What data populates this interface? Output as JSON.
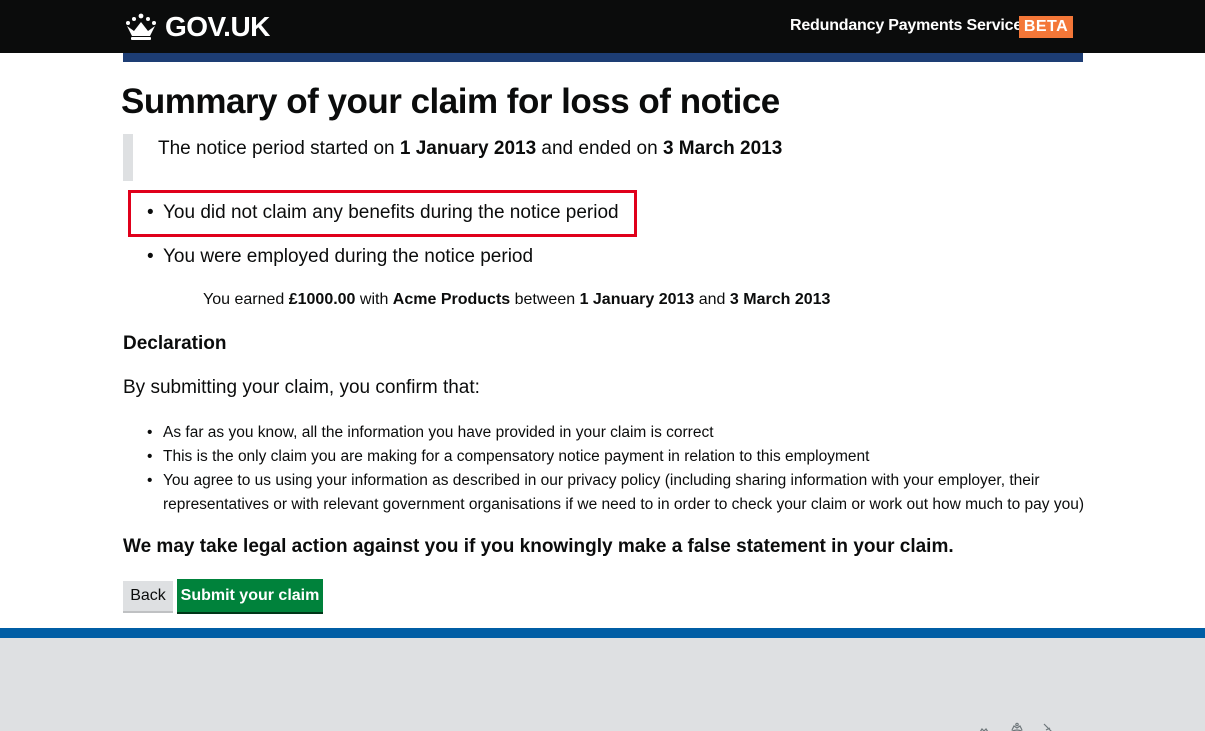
{
  "header": {
    "logo_text": "GOV.UK",
    "service_name": "Redundancy Payments Service",
    "phase_tag": "BETA"
  },
  "page": {
    "title": "Summary of your claim for loss of notice"
  },
  "notice": {
    "prefix": "The notice period started on ",
    "start_date": "1 January 2013",
    "middle": " and ended on ",
    "end_date": "3 March 2013"
  },
  "summary": {
    "benefits": "You did not claim any benefits during the notice period",
    "employment": "You were employed during the notice period",
    "earned": {
      "prefix": "You earned ",
      "amount": "£1000.00",
      "with": " with ",
      "employer": "Acme Products",
      "between": " between ",
      "start_date": "1 January 2013",
      "and": " and ",
      "end_date": "3 March 2013"
    }
  },
  "declaration": {
    "heading": "Declaration",
    "intro": "By submitting your claim, you confirm that:",
    "items": [
      "As far as you know, all the information you have provided in your claim is correct",
      "This is the only claim you are making for a compensatory notice payment in relation to this employment",
      "You agree to us using your information as described in our privacy policy (including sharing information with your employer, their representatives or with relevant government organisations if we need to in order to check your claim or work out how much to pay you)"
    ],
    "warning": "We may take legal action against you if you knowingly make a false statement in your claim."
  },
  "actions": {
    "back_label": "Back",
    "submit_label": "Submit your claim"
  },
  "colors": {
    "header_bg": "#0b0c0c",
    "header_bar": "#1d3d74",
    "phase_tag": "#f47738",
    "highlight": "#e0001b",
    "submit_button": "#00823b",
    "footer_bg": "#dee0e2",
    "footer_border": "#005ea5"
  },
  "icons": {
    "logo": "crown-icon",
    "footer": "royal-coat-of-arms-icon"
  }
}
